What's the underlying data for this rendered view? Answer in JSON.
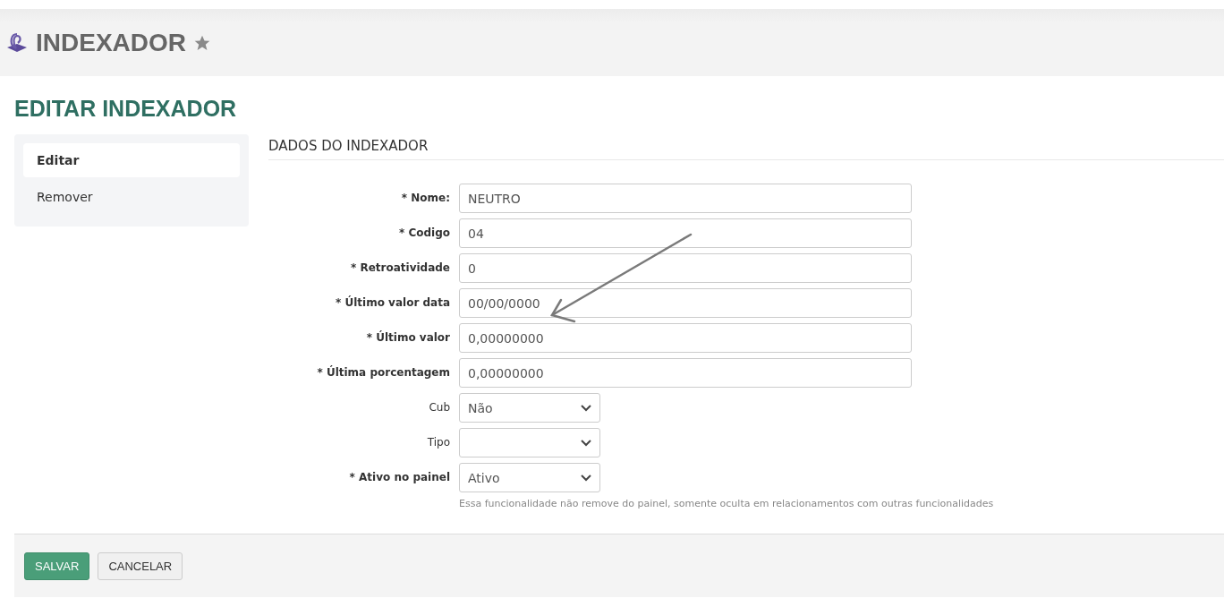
{
  "header": {
    "title": "INDEXADOR"
  },
  "page_title": "EDITAR INDEXADOR",
  "sidebar": {
    "items": [
      {
        "label": "Editar",
        "selected": true
      },
      {
        "label": "Remover",
        "selected": false
      }
    ]
  },
  "section_title": "DADOS DO INDEXADOR",
  "fields": [
    {
      "kind": "text",
      "label": "* Nome:",
      "required": true,
      "value": "NEUTRO"
    },
    {
      "kind": "text",
      "label": "* Codigo",
      "required": true,
      "value": "04"
    },
    {
      "kind": "text",
      "label": "* Retroatividade",
      "required": true,
      "value": "0"
    },
    {
      "kind": "text",
      "label": "* Último valor data",
      "required": true,
      "value": "00/00/0000"
    },
    {
      "kind": "text",
      "label": "* Último valor",
      "required": true,
      "value": "0,00000000"
    },
    {
      "kind": "text",
      "label": "* Última porcentagem",
      "required": true,
      "value": "0,00000000"
    },
    {
      "kind": "select",
      "label": "Cub",
      "required": false,
      "value": "Não"
    },
    {
      "kind": "select",
      "label": "Tipo",
      "required": false
    },
    {
      "kind": "select",
      "label": "* Ativo no painel",
      "required": true,
      "value": "Ativo",
      "hint": "Essa funcionalidade não remove do painel, somente oculta em relacionamentos com outras funcionalidades"
    }
  ],
  "buttons": [
    {
      "kind": "primary",
      "label": "SALVAR"
    },
    {
      "kind": "secondary",
      "label": "CANCELAR"
    }
  ]
}
